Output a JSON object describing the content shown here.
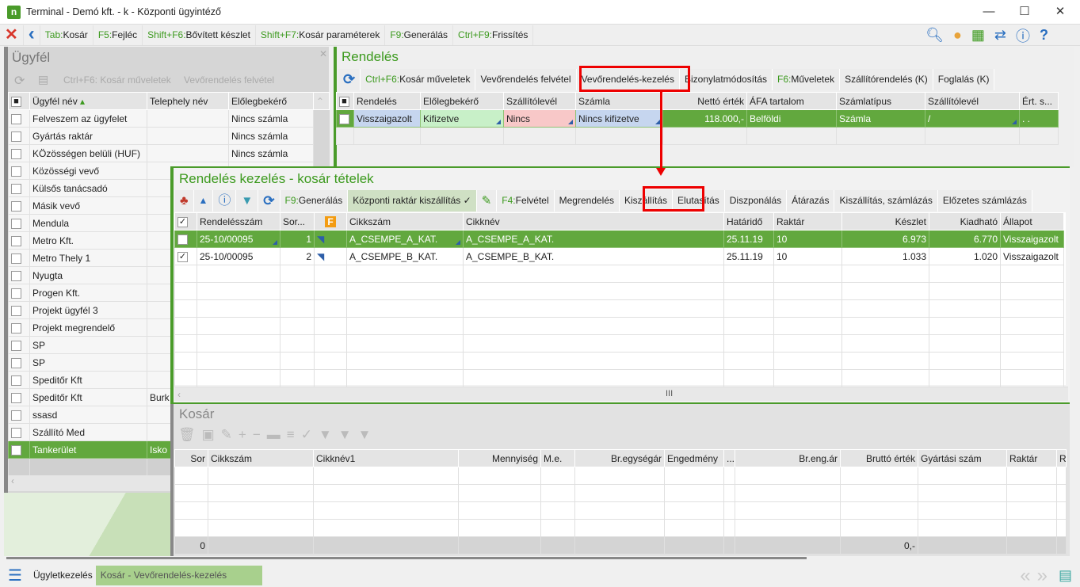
{
  "window": {
    "title": "Terminal - Demó kft. - k - Központi ügyintéző",
    "logo": "n",
    "minimize": "—",
    "maximize": "☐",
    "close": "✕"
  },
  "toolbar": {
    "items": [
      {
        "key": "Tab:",
        "label": "Kosár"
      },
      {
        "key": "F5:",
        "label": "Fejléc"
      },
      {
        "key": "Shift+F6:",
        "label": "Bővített készlet"
      },
      {
        "key": "Shift+F7:",
        "label": "Kosár paraméterek"
      },
      {
        "key": "F9:",
        "label": "Generálás"
      },
      {
        "key": "Ctrl+F9:",
        "label": "Frissítés"
      }
    ],
    "close_icon": "✕",
    "back_icon": "‹",
    "right_icons": [
      "search-icon",
      "user-icon",
      "apps-icon",
      "swap-icon",
      "info-icon",
      "help-icon"
    ]
  },
  "customer": {
    "title": "Ügyfél",
    "close": "✕",
    "actions": [
      "Ctrl+F6: Kosár műveletek",
      "Vevőrendelés felvétel"
    ],
    "columns": [
      "Ügyfél név",
      "Telephely név",
      "Előlegbekérő"
    ],
    "rows": [
      [
        "Felveszem az ügyfelet",
        "",
        "Nincs számla"
      ],
      [
        "Gyártás raktár",
        "",
        "Nincs számla"
      ],
      [
        "KÖzösségen belüli (HUF)",
        "",
        "Nincs számla"
      ],
      [
        "Közösségi vevő",
        "",
        ""
      ],
      [
        "Külsős tanácsadó",
        "",
        ""
      ],
      [
        "Másik vevő",
        "",
        ""
      ],
      [
        "Mendula",
        "",
        ""
      ],
      [
        "Metro Kft.",
        "",
        ""
      ],
      [
        "Metro Thely 1",
        "",
        ""
      ],
      [
        "Nyugta",
        "",
        ""
      ],
      [
        "Progen Kft.",
        "",
        ""
      ],
      [
        "Projekt  ügyfél 3",
        "",
        ""
      ],
      [
        "Projekt megrendelő",
        "",
        ""
      ],
      [
        "SP",
        "",
        ""
      ],
      [
        "SP",
        "",
        ""
      ],
      [
        "Speditőr Kft",
        "",
        ""
      ],
      [
        "Speditőr Kft",
        "Burk",
        ""
      ],
      [
        "ssasd",
        "",
        ""
      ],
      [
        "Szállító Med",
        "",
        ""
      ],
      [
        "Tankerület",
        "Isko",
        ""
      ]
    ],
    "selected_index": 19
  },
  "order": {
    "title": "Rendelés",
    "actions": [
      {
        "key": "Ctrl+F6:",
        "label": "Kosár műveletek"
      },
      {
        "key": "",
        "label": "Vevőrendelés felvétel"
      },
      {
        "key": "",
        "label": "Vevőrendelés-kezelés"
      },
      {
        "key": "",
        "label": "Bizonylatmódosítás"
      },
      {
        "key": "F6:",
        "label": "Műveletek"
      },
      {
        "key": "",
        "label": "Szállítórendelés (K)"
      },
      {
        "key": "",
        "label": "Foglalás (K)"
      }
    ],
    "columns": [
      "Rendelés",
      "Előlegbekérő",
      "Szállítólevél",
      "Számla",
      "Nettó érték",
      "ÁFA tartalom",
      "Számlatípus",
      "Szállítólevél",
      "Ért. s..."
    ],
    "row": [
      "Visszaigazolt",
      "Kifizetve",
      "Nincs",
      "Nincs kifizetve",
      "118.000,-",
      "Belföldi",
      "Számla",
      "/",
      ". ."
    ]
  },
  "basket_items": {
    "title": "Rendelés kezelés - kosár tételek",
    "actions": [
      {
        "key": "F9:",
        "label": "Generálás"
      },
      {
        "key": "",
        "label": "Központi raktár kiszállítás ✓"
      },
      {
        "key": "F4:",
        "label": "Felvétel"
      },
      {
        "key": "",
        "label": "Megrendelés"
      },
      {
        "key": "",
        "label": "Kiszállítás"
      },
      {
        "key": "",
        "label": "Elutasítás"
      },
      {
        "key": "",
        "label": "Diszponálás"
      },
      {
        "key": "",
        "label": "Átárazás"
      },
      {
        "key": "",
        "label": "Kiszállítás, számlázás"
      },
      {
        "key": "",
        "label": "Előzetes számlázás"
      }
    ],
    "columns": [
      "Rendelésszám",
      "Sor...",
      "F",
      "Cikkszám",
      "Cikknév",
      "Határidő",
      "Raktár",
      "Készlet",
      "Kiadható",
      "Állapot"
    ],
    "rows": [
      [
        "25-10/00095",
        "1",
        "",
        "A_CSEMPE_A_KAT.",
        "A_CSEMPE_A_KAT.",
        "25.11.19",
        "10",
        "6.973",
        "6.770",
        "Visszaigazolt"
      ],
      [
        "25-10/00095",
        "2",
        "",
        "A_CSEMPE_B_KAT.",
        "A_CSEMPE_B_KAT.",
        "25.11.19",
        "10",
        "1.033",
        "1.020",
        "Visszaigazolt"
      ]
    ],
    "selected_index": 0,
    "scroll_handle": "III"
  },
  "basket": {
    "title": "Kosár",
    "columns": [
      "Sor",
      "Cikkszám",
      "Cikknév1",
      "Mennyiség",
      "M.e.",
      "Br.egységár",
      "Engedmény",
      "...",
      "Br.eng.ár",
      "Bruttó érték",
      "Gyártási szám",
      "Raktár",
      "R"
    ],
    "footer_count": "0",
    "footer_total": "0,-"
  },
  "statusbar": {
    "tabs": [
      "Ügyletkezelés",
      "Kosár - Vevőrendelés-kezelés"
    ],
    "active": 1,
    "prev": "«",
    "next": "»"
  },
  "colors": {
    "accent": "#4a9b2a",
    "selected_row": "#62a83e",
    "highlight": "#e00000"
  }
}
